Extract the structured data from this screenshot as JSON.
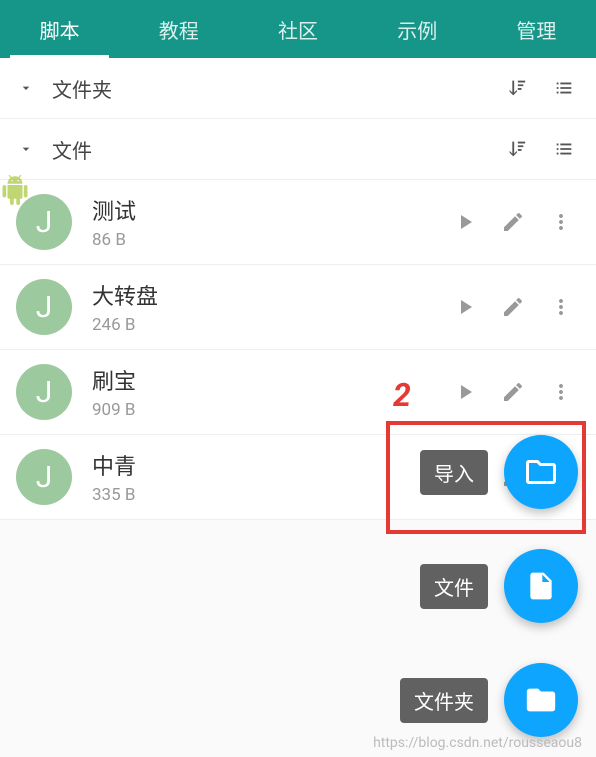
{
  "tabs": [
    {
      "label": "脚本",
      "active": true
    },
    {
      "label": "教程",
      "active": false
    },
    {
      "label": "社区",
      "active": false
    },
    {
      "label": "示例",
      "active": false
    },
    {
      "label": "管理",
      "active": false
    }
  ],
  "sections": {
    "folder": {
      "label": "文件夹"
    },
    "file": {
      "label": "文件"
    }
  },
  "files": [
    {
      "initial": "J",
      "name": "测试",
      "size": "86 B"
    },
    {
      "initial": "J",
      "name": "大转盘",
      "size": "246 B"
    },
    {
      "initial": "J",
      "name": "刷宝",
      "size": "909 B"
    },
    {
      "initial": "J",
      "name": "中青",
      "size": "335 B"
    }
  ],
  "fabs": [
    {
      "label": "导入",
      "icon": "folder-open"
    },
    {
      "label": "文件",
      "icon": "file"
    },
    {
      "label": "文件夹",
      "icon": "folder"
    }
  ],
  "annotation": {
    "text": "2"
  },
  "watermark": "https://blog.csdn.net/rousseaou8"
}
